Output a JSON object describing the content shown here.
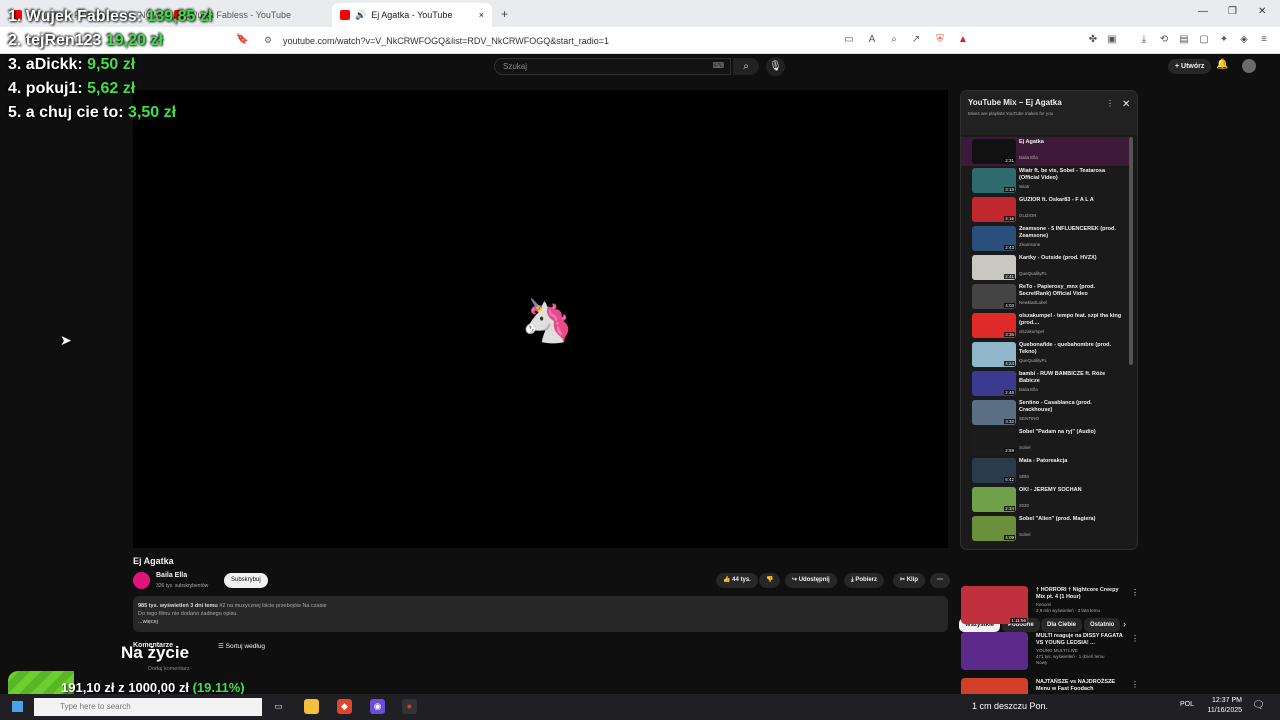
{
  "browser": {
    "tabs": [
      {
        "label": "...SYSTEM PODCAST · YT NOWSKI"
      },
      {
        "label": "Wujek Fabless - YouTube"
      },
      {
        "label": "Ej Agatka - YouTube",
        "active": true
      }
    ],
    "url": "youtube.com/watch?v=V_NkCRWFOGQ&list=RDV_NkCRWFOGQ&start_radio=1",
    "new_tab": "+",
    "close_tab": "×"
  },
  "youtube": {
    "search_placeholder": "Szukaj",
    "create_label": "+ Utwórz",
    "video": {
      "title": "Ej Agatka",
      "channel": "Baila Ella",
      "subscribers": "326 tys. subskrybentów",
      "subscribe_label": "Subskrybuj",
      "likes": "44 tys.",
      "share_label": "Udostępnij",
      "download_label": "Pobierz",
      "clip_label": "Klip",
      "description": {
        "stats": "985 tys. wyświetleń  3 dni temu",
        "tags": "#2 na muzycznej liście przebojów Na czasie",
        "text": "Do tego filmu nie dodano żadnego opisu.",
        "more": "...więcej"
      },
      "comments_label": "Komentarze",
      "sort_label": "Sortuj według",
      "add_comment": "Dodaj komentarz"
    },
    "playlist": {
      "title": "YouTube Mix – Ej Agatka",
      "subtitle": "Mixes are playlists YouTube makes for you",
      "items": [
        {
          "title": "Ej Agatka",
          "artist": "Baila Ella",
          "duration": "2:31",
          "color": "#111"
        },
        {
          "title": "Wiatr ft. be vis, Sobel - Teatarosa (Official Video)",
          "artist": "Wiatr",
          "duration": "3:13",
          "color": "#2f6b6e"
        },
        {
          "title": "GUZIOR ft. Oskar83 - F A L A",
          "artist": "GUZIOR",
          "duration": "4:16",
          "color": "#c0282d"
        },
        {
          "title": "Zeamsone - 5 INFLUENCEREK (prod. Zeamsone)",
          "artist": "Zeamsone",
          "duration": "2:43",
          "color": "#2a4f7a"
        },
        {
          "title": "Kartky - Outside (prod. HVZX)",
          "artist": "QueQualityPL",
          "duration": "2:41",
          "color": "#c8c8c0"
        },
        {
          "title": "ReTo - Papierosy_mnx (prod. SecretRank) Official Video",
          "artist": "NewBadLabel",
          "duration": "4:03",
          "color": "#444"
        },
        {
          "title": "olszakumpel - tempo feat. szpi tha king (prod....",
          "artist": "olszakumpel",
          "duration": "3:36",
          "color": "#e02a2a"
        },
        {
          "title": "Quebonafide - quebahombre (prod. Tekno)",
          "artist": "QueQualityPL",
          "duration": "4:24",
          "color": "#8fb7c9"
        },
        {
          "title": "bambi - RUW BAMBICZE ft. Róże Babicze",
          "artist": "Baila Ella",
          "duration": "2:48",
          "color": "#3b3a8f"
        },
        {
          "title": "Sentino - Casablanca (prod. Crackhouse)",
          "artist": "SENTINO",
          "duration": "3:32",
          "color": "#5a6f84"
        },
        {
          "title": "Sobel \"Padam na ryj\" (Audio)",
          "artist": "Sobel",
          "duration": "2:59",
          "color": "#1c1c1c"
        },
        {
          "title": "Mata - Patoreakcja",
          "artist": "SBM",
          "duration": "6:42",
          "color": "#2a3b4c"
        },
        {
          "title": "OKI - JEREMY SOCHAN",
          "artist": "2020",
          "duration": "2:34",
          "color": "#6fa04a"
        },
        {
          "title": "Sobel \"Alien\" (prod. Magiera)",
          "artist": "Sobel",
          "duration": "4:09",
          "color": "#6b8f3a"
        }
      ]
    },
    "chips": [
      "Wszystkie",
      "Podobne",
      "Dla Ciebie",
      "Ostatnio"
    ],
    "recommendations": [
      {
        "title": "† HORRORI † Nightcore Creepy Mix pt. 4 (1 Hour)",
        "channel": "Kenomi",
        "meta": "2,9 mln wyświetleń · 3 lata temu",
        "duration": "1:11:56",
        "color": "#c0303d"
      },
      {
        "title": "MULTI reaguje na DISSY FAGATA VS YOUNG LEOSIA! ...",
        "channel": "YOUNG MULTI LIVE",
        "meta": "471 tys. wyświetleń · 1 dzień temu",
        "badge": "Nowy",
        "color": "#5b2a8a"
      },
      {
        "title": "NAJTAŃSZE vs NAJDROŻSZE Menu w Fast Foodach",
        "channel": "",
        "meta": "",
        "color": "#d2402a"
      }
    ]
  },
  "overlay": {
    "donations": [
      {
        "rank": "1. Wujek Fabless:",
        "amount": "139,85 zł"
      },
      {
        "rank": "2. tejRen123",
        "amount": "19,20 zł"
      },
      {
        "rank": "3. aDickk:",
        "amount": "9,50 zł"
      },
      {
        "rank": "4. pokuj1:",
        "amount": "5,62 zł"
      },
      {
        "rank": "5. a chuj cie to:",
        "amount": "3,50 zł"
      }
    ],
    "goal_label": "Na życie",
    "goal_current": "191,10 zł",
    "goal_sep": " z ",
    "goal_target": "1000,00 zł",
    "goal_percent": "(19.11%)",
    "goal_fraction": 0.1911
  },
  "taskbar": {
    "search_placeholder": "Type here to search",
    "weather": "1 cm deszczu Pon.",
    "lang": "POL",
    "time": "12:37 PM",
    "date": "11/16/2025"
  }
}
